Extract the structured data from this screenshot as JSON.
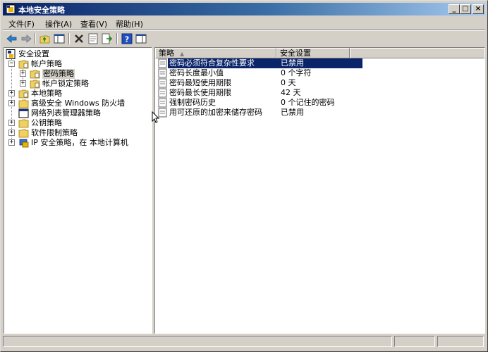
{
  "window": {
    "title": "本地安全策略",
    "controls": {
      "minimize": "_",
      "maximize": "□",
      "close": "×"
    }
  },
  "menu": [
    "文件(F)",
    "操作(A)",
    "查看(V)",
    "帮助(H)"
  ],
  "toolbar": {
    "icons": [
      "back-icon",
      "forward-icon",
      "up-folder-icon",
      "show-hide-tree-icon",
      "delete-icon",
      "properties-icon",
      "export-list-icon",
      "help-icon",
      "view-icon"
    ]
  },
  "tree": {
    "root": "安全设置",
    "items": [
      {
        "label": "帐户策略",
        "expanded": true
      },
      {
        "label": "密码策略",
        "selected": true
      },
      {
        "label": "帐户锁定策略"
      },
      {
        "label": "本地策略"
      },
      {
        "label": "高级安全 Windows 防火墙"
      },
      {
        "label": "网络列表管理器策略"
      },
      {
        "label": "公钥策略"
      },
      {
        "label": "软件限制策略"
      },
      {
        "label": "IP 安全策略，在 本地计算机"
      }
    ]
  },
  "list": {
    "columns": [
      "策略",
      "安全设置"
    ],
    "rows": [
      {
        "policy": "密码必须符合复杂性要求",
        "setting": "已禁用",
        "selected": true
      },
      {
        "policy": "密码长度最小值",
        "setting": "0 个字符"
      },
      {
        "policy": "密码最短使用期限",
        "setting": "0 天"
      },
      {
        "policy": "密码最长使用期限",
        "setting": "42 天"
      },
      {
        "policy": "强制密码历史",
        "setting": "0 个记住的密码"
      },
      {
        "policy": "用可还原的加密来储存密码",
        "setting": "已禁用"
      }
    ]
  },
  "colors": {
    "title_bar": "#0a246a",
    "selection": "#0a246a",
    "face": "#d4d0c8"
  }
}
